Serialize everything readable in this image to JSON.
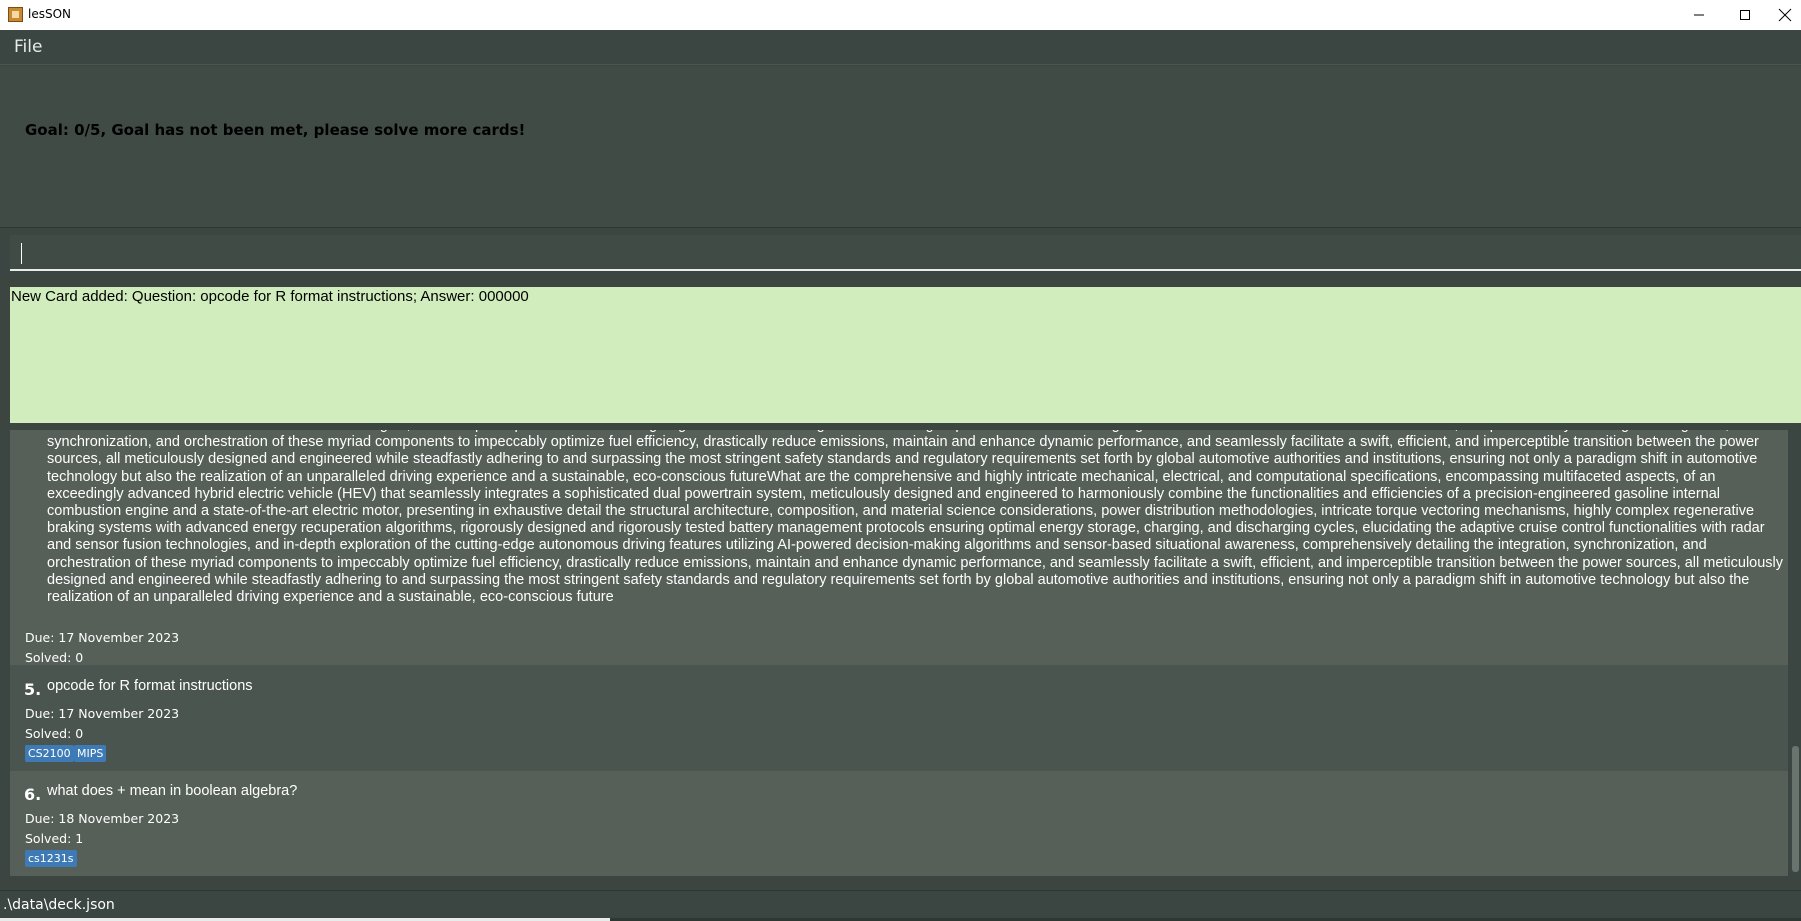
{
  "window": {
    "title": "lesSON",
    "minimize_icon": "minimize-icon",
    "maximize_icon": "maximize-icon",
    "close_icon": "close-icon"
  },
  "menu": {
    "file_label": "File"
  },
  "goal": {
    "text": "Goal: 0/5, Goal has not been met, please solve more cards!"
  },
  "command": {
    "value": ""
  },
  "result": {
    "text": "New Card added: Question: opcode for R format instructions; Answer: 000000"
  },
  "cards": [
    {
      "index": "",
      "question": "functionalities with radar and sensor fusion technologies, and in-depth exploration of the cutting-edge autonomous driving features utilizing AI-powered decision-making algorithms and sensor-based situational awareness, comprehensively detailing the integration, synchronization, and orchestration of these myriad components to impeccably optimize fuel efficiency, drastically reduce emissions, maintain and enhance dynamic performance, and seamlessly facilitate a swift, efficient, and imperceptible transition between the power sources, all meticulously designed and engineered while steadfastly adhering to and surpassing the most stringent safety standards and regulatory requirements set forth by global automotive authorities and institutions, ensuring not only a paradigm shift in automotive technology but also the realization of an unparalleled driving experience and a sustainable, eco-conscious futureWhat are the comprehensive and highly intricate mechanical, electrical, and computational specifications, encompassing multifaceted aspects, of an exceedingly advanced hybrid electric vehicle (HEV) that seamlessly integrates a sophisticated dual powertrain system, meticulously designed and engineered to harmoniously combine the functionalities and efficiencies of a precision-engineered gasoline internal combustion engine and a state-of-the-art electric motor, presenting in exhaustive detail the structural architecture, composition, and material science considerations, power distribution methodologies, intricate torque vectoring mechanisms, highly complex regenerative braking systems with advanced energy recuperation algorithms, rigorously designed and rigorously tested battery management protocols ensuring optimal energy storage, charging, and discharging cycles, elucidating the adaptive cruise control functionalities with radar and sensor fusion technologies, and in-depth exploration of the cutting-edge autonomous driving features utilizing AI-powered decision-making algorithms and sensor-based situational awareness, comprehensively detailing the integration, synchronization, and orchestration of these myriad components to impeccably optimize fuel efficiency, drastically reduce emissions, maintain and enhance dynamic performance, and seamlessly facilitate a swift, efficient, and imperceptible transition between the power sources, all meticulously designed and engineered while steadfastly adhering to and surpassing the most stringent safety standards and regulatory requirements set forth by global automotive authorities and institutions, ensuring not only a paradigm shift in automotive technology but also the realization of an unparalleled driving experience and a sustainable, eco-conscious future",
      "due": "Due: 17 November 2023",
      "solved": "Solved: 0",
      "tags": []
    },
    {
      "index": "5.",
      "question": "opcode for R format instructions",
      "due": "Due: 17 November 2023",
      "solved": "Solved: 0",
      "tags": [
        "CS2100",
        "MIPS"
      ]
    },
    {
      "index": "6.",
      "question": "what does + mean in boolean algebra?",
      "due": "Due: 18 November 2023",
      "solved": "Solved: 1",
      "tags": [
        "cs1231s"
      ]
    }
  ],
  "status": {
    "path": ".\\data\\deck.json"
  }
}
